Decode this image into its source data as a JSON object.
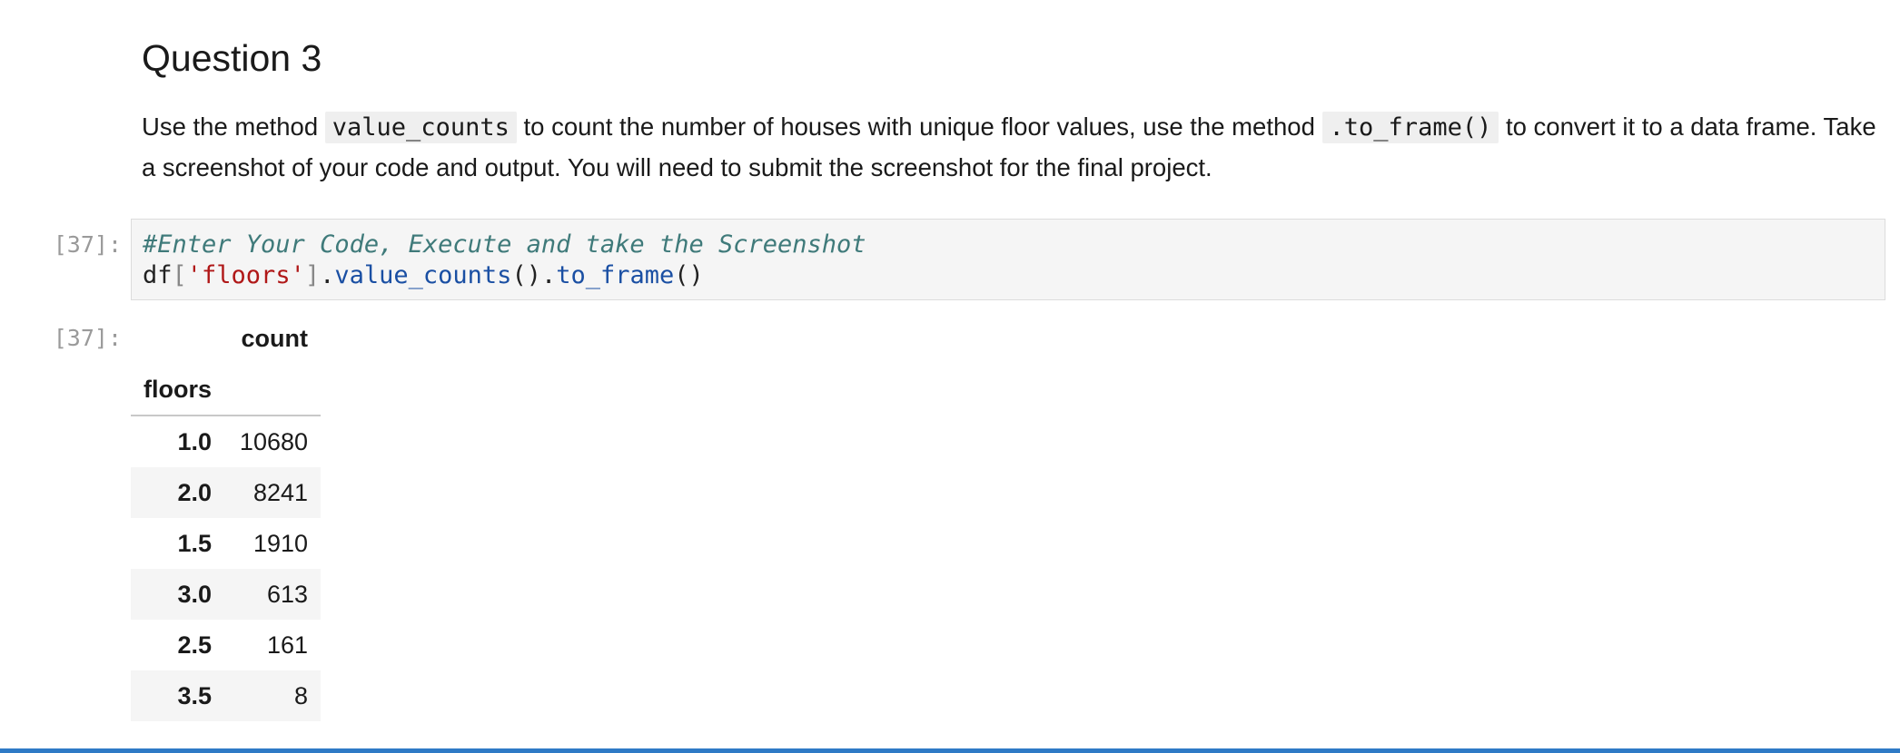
{
  "question": {
    "title": "Question 3",
    "text_1": "Use the method ",
    "code_1": "value_counts",
    "text_2": " to count the number of houses with unique floor values, use the method ",
    "code_2": ".to_frame()",
    "text_3": " to convert it to a data frame. Take a screenshot of your code and output. You will need to submit the screenshot for the final project."
  },
  "code_cell": {
    "prompt": "[37]:",
    "comment": "#Enter Your Code, Execute and take the Screenshot",
    "line2": {
      "var": "df",
      "open": "[",
      "key": "'floors'",
      "close": "]",
      "dot1": ".",
      "fn1": "value_counts",
      "call1": "()",
      "dot2": ".",
      "fn2": "to_frame",
      "call2": "()"
    }
  },
  "output": {
    "prompt": "[37]:",
    "column_header": "count",
    "index_name": "floors",
    "rows": [
      {
        "index": "1.0",
        "count": "10680"
      },
      {
        "index": "2.0",
        "count": "8241"
      },
      {
        "index": "1.5",
        "count": "1910"
      },
      {
        "index": "3.0",
        "count": "613"
      },
      {
        "index": "2.5",
        "count": "161"
      },
      {
        "index": "3.5",
        "count": "8"
      }
    ]
  },
  "colors": {
    "accent_bar": "#2f7ac6",
    "comment": "#3f7a7a",
    "string": "#b01818",
    "function": "#1a4fa3"
  }
}
